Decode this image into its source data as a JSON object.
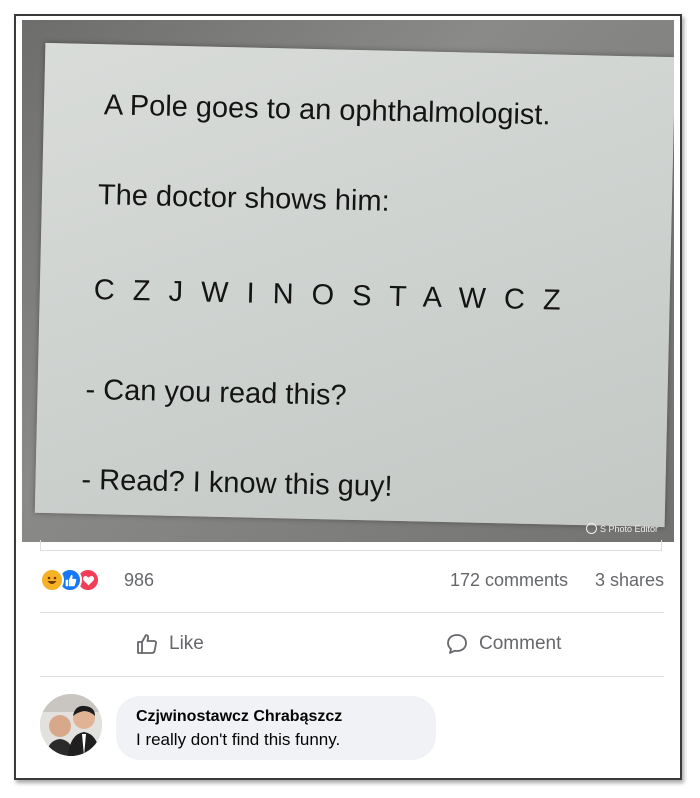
{
  "post": {
    "photo_lines": [
      "A Pole goes to an ophthalmologist.",
      "The doctor shows him:",
      "C Z J W I N O S T A W C Z",
      "- Can you read this?",
      "- Read? I know this guy!"
    ],
    "watermark": "S Photo Editor"
  },
  "stats": {
    "reaction_icons": [
      "haha-emoji-icon",
      "like-emoji-icon",
      "love-emoji-icon"
    ],
    "reaction_count": "986",
    "comments": "172 comments",
    "shares": "3 shares"
  },
  "actions": {
    "like_label": "Like",
    "comment_label": "Comment"
  },
  "comment": {
    "author": "Czjwinostawcz Chrabąszcz",
    "text": "I really don't find this funny."
  },
  "colors": {
    "like_blue": "#1877f2",
    "love_red": "#f33e58",
    "haha_yellow": "#f7b125",
    "muted_text": "#65676b",
    "bubble_bg": "#f0f2f5"
  }
}
